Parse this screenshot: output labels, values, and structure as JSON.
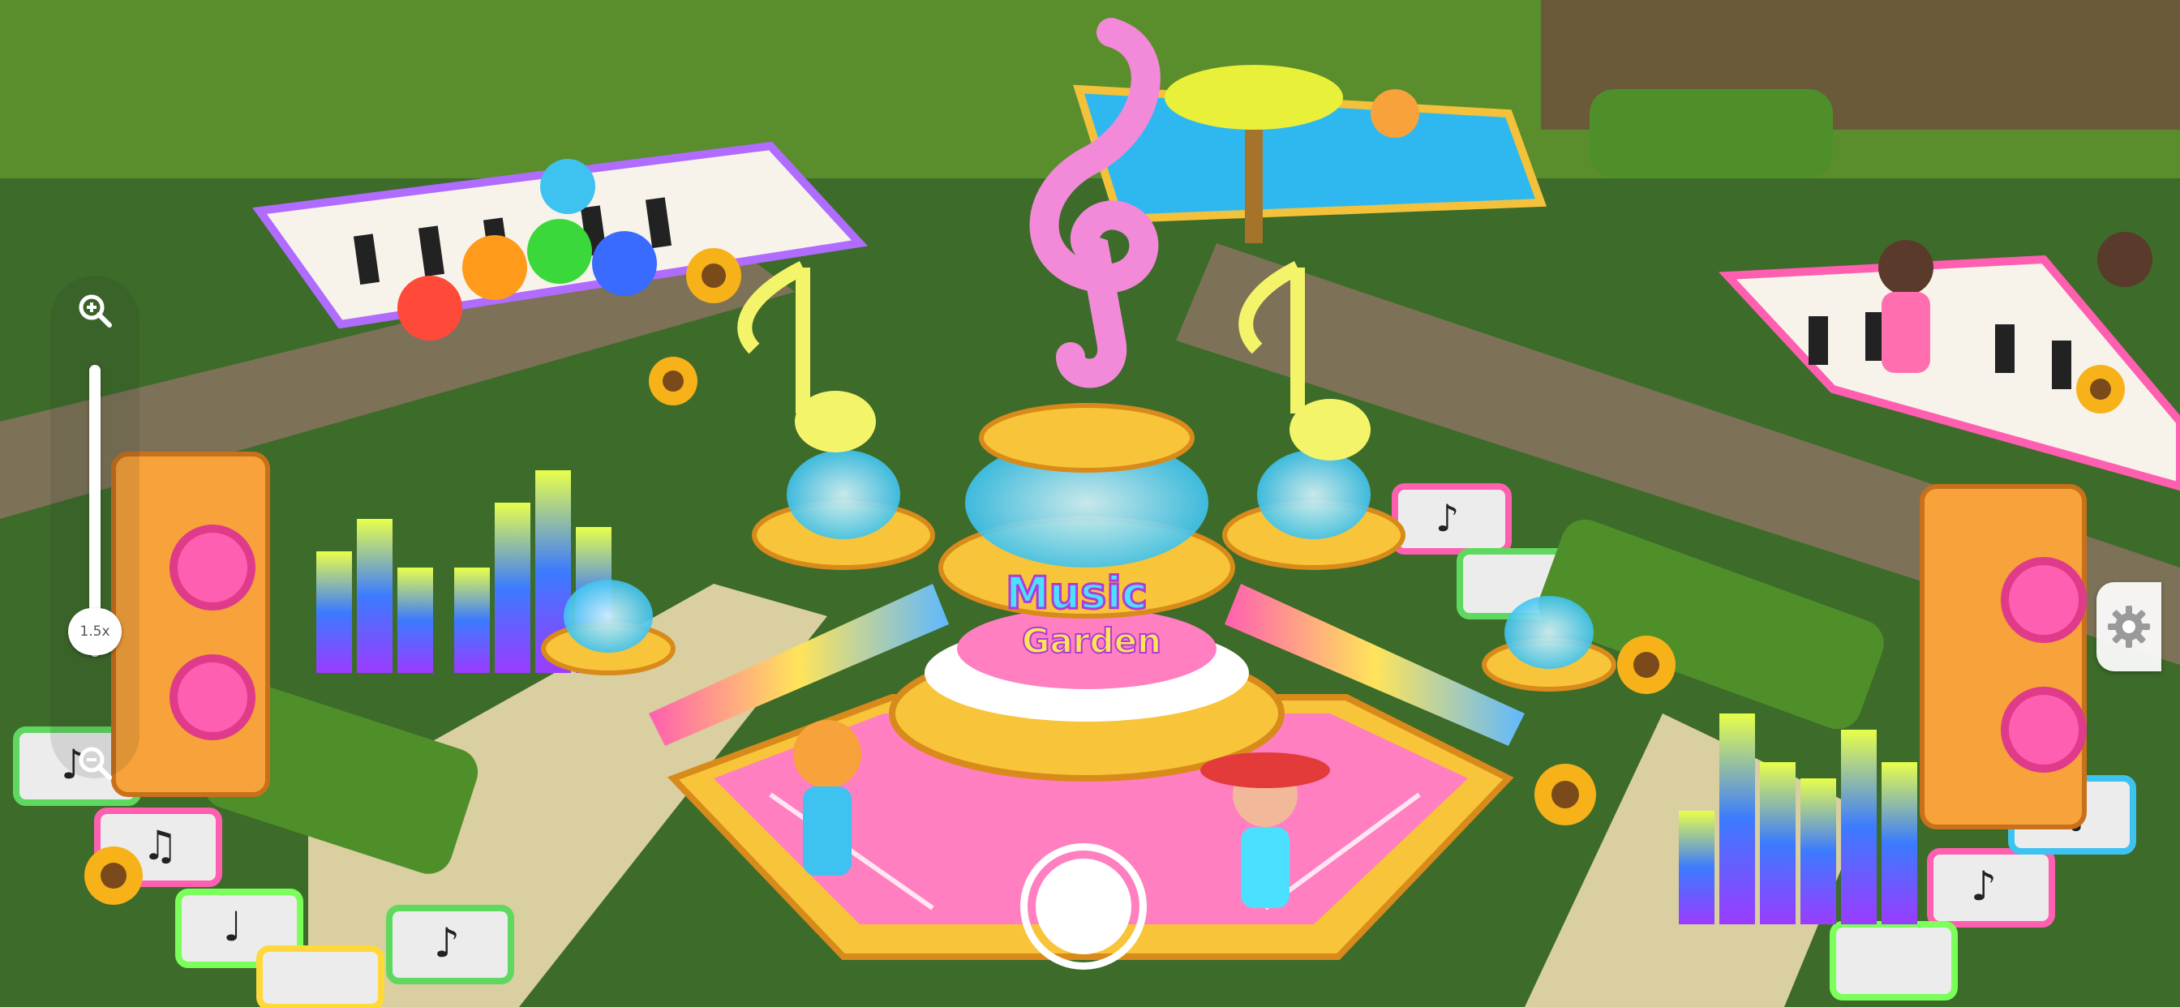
{
  "zoom": {
    "level_label": "1.5x",
    "zoom_in_icon": "zoom-in-magnifier-icon",
    "zoom_out_icon": "zoom-out-magnifier-icon"
  },
  "scene": {
    "sign_text_line1": "Music",
    "sign_text_line2": "Garden"
  },
  "controls": {
    "settings_icon": "gear-icon",
    "shutter_icon": "camera-shutter-icon"
  },
  "colors": {
    "grass": "#3d6b2a",
    "path": "#8a7a5e",
    "fountain_gold": "#f7c43a",
    "note_yellow": "#f4f46a",
    "treble_pink": "#f28ad9"
  }
}
